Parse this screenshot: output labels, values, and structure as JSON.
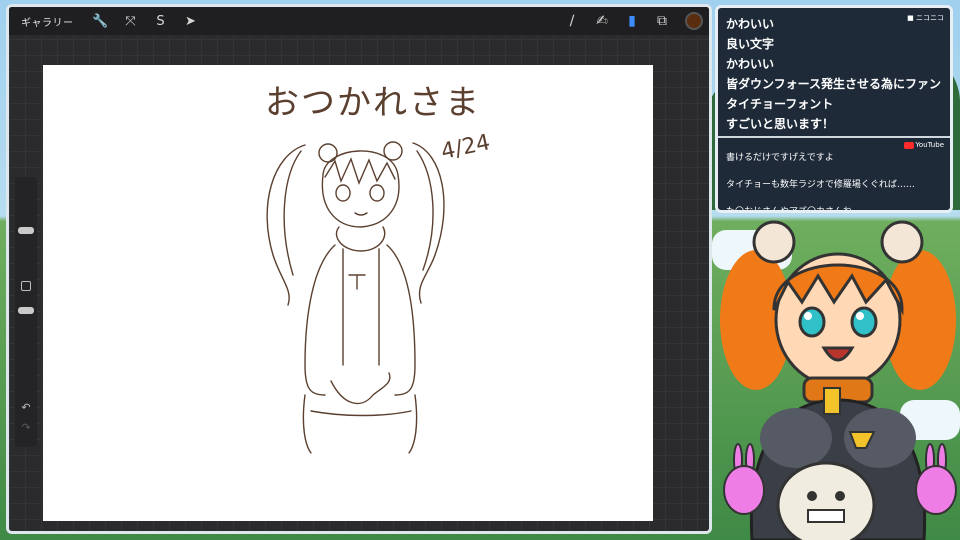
{
  "app": {
    "gallery_label": "ギャラリー",
    "left_tools": [
      "wrench-icon",
      "magic-wand-icon",
      "selection-icon",
      "transform-icon"
    ],
    "right_tools": [
      "brush-icon",
      "smudge-icon",
      "eraser-icon",
      "layers-icon"
    ],
    "active_tool": "eraser-icon",
    "current_color": "#5a2d0f"
  },
  "canvas": {
    "sketch_title": "おつかれさま",
    "sketch_date": "4/24"
  },
  "comments": {
    "niconico_label": "ニコニコ",
    "niconico": [
      "かわいい",
      "良い文字",
      "かわいい",
      "皆ダウンフォース発生させる為にファン",
      "タイチョーフォント",
      "すごいと思います！"
    ],
    "youtube_label": "YouTube",
    "youtube": [
      "書けるだけですげえですよ",
      "タイチョーも数年ラジオで修羅場くぐれば……",
      "た〇おじさんやアズ〇カさんね"
    ]
  }
}
